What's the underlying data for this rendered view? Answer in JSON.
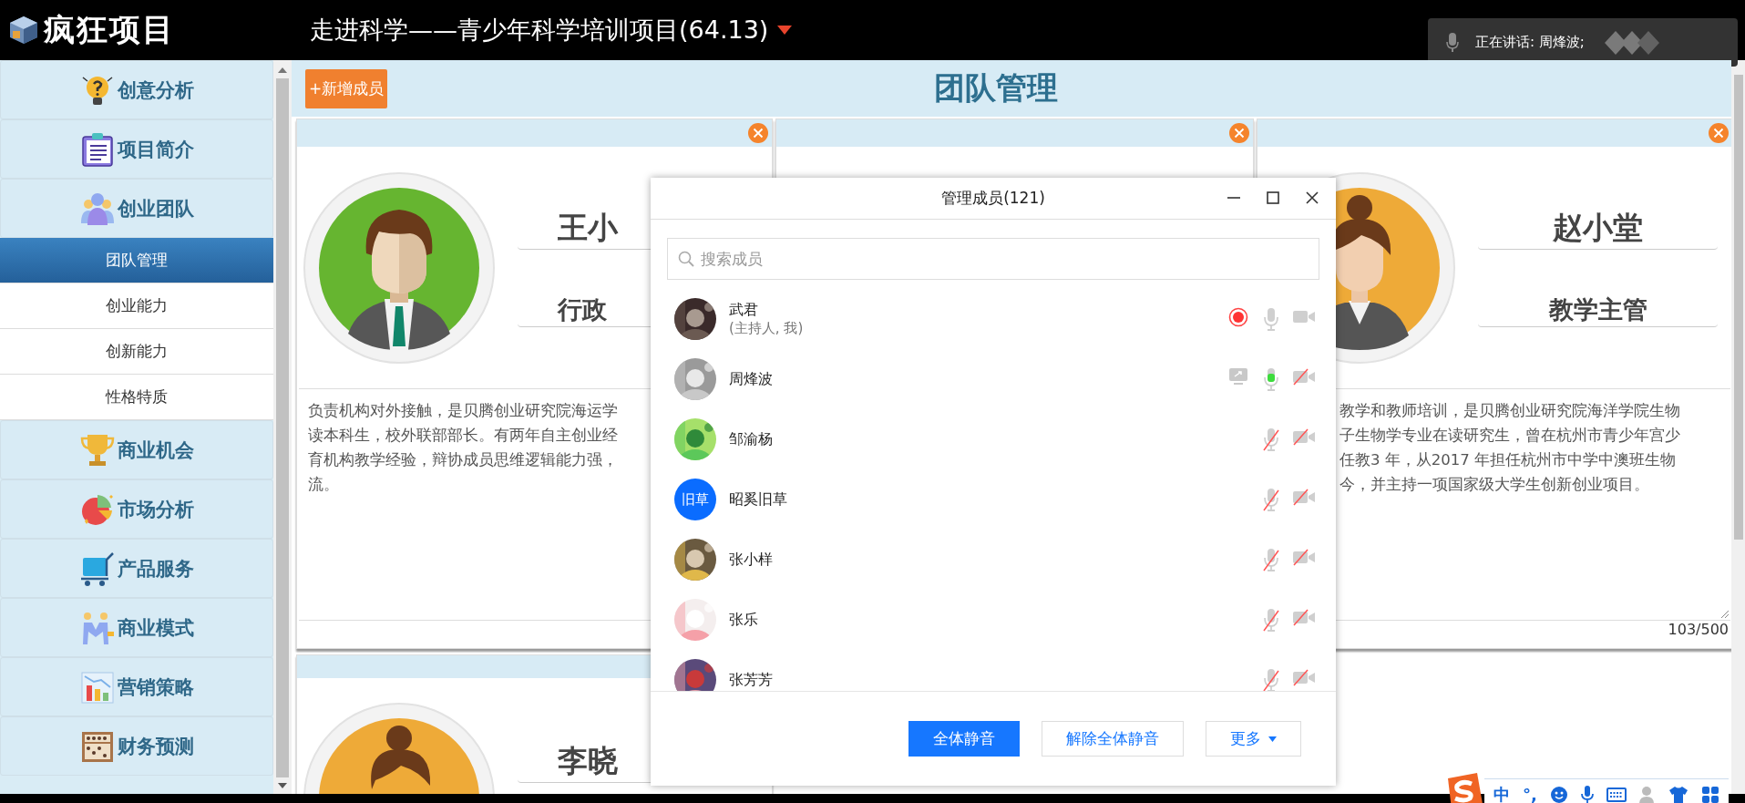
{
  "header": {
    "logo": "疯狂项目",
    "project_title": "走进科学——青少年科学培训项目(64.13)"
  },
  "speaking_indicator": {
    "label": "正在讲话: 周烽波;"
  },
  "sidebar": {
    "items": [
      {
        "label": "创意分析"
      },
      {
        "label": "项目简介"
      },
      {
        "label": "创业团队",
        "children": [
          {
            "label": "团队管理",
            "selected": true
          },
          {
            "label": "创业能力",
            "selected": false
          },
          {
            "label": "创新能力",
            "selected": false
          },
          {
            "label": "性格特质",
            "selected": false
          }
        ]
      },
      {
        "label": "商业机会"
      },
      {
        "label": "市场分析"
      },
      {
        "label": "产品服务"
      },
      {
        "label": "商业模式"
      },
      {
        "label": "营销策略"
      },
      {
        "label": "财务预测"
      }
    ]
  },
  "page": {
    "add_button": "+新增成员",
    "title": "团队管理"
  },
  "cards": [
    {
      "kind": "profile",
      "name": "王小",
      "role": "行政",
      "description_lines": [
        "负责机构对外接触，是贝腾创业研究院海运学",
        "读本科生，校外联部部长。有两年自主创业经",
        "育机构教学经验，辩协成员思维逻辑能力强，",
        "流。"
      ]
    },
    {
      "kind": "covered"
    },
    {
      "kind": "profile",
      "name": "赵小堂",
      "role": "教学主管",
      "description_lines": [
        "教学和教师培训，是贝腾创业研究院海洋学院生物",
        "子生物学专业在读研究生，曾在杭州市青少年宫少",
        "任教3 年，从2017 年担任杭州市中学中澳班生物",
        "今，并主持一项国家级大学生创新创业项目。"
      ],
      "counter": "103/500"
    }
  ],
  "cards_row_2": [
    {
      "name": "李晓"
    }
  ],
  "dialog": {
    "title": "管理成员(121)",
    "search": {
      "placeholder": "搜索成员"
    },
    "members": [
      {
        "name": "武君",
        "note": "(主持人, 我)",
        "recording": true,
        "sharing": false,
        "mic_muted": false,
        "speaking": false,
        "camera_off": false
      },
      {
        "name": "周烽波",
        "recording": false,
        "sharing": true,
        "mic_muted": false,
        "speaking": true,
        "camera_off": true
      },
      {
        "name": "邹渝杨",
        "recording": false,
        "sharing": false,
        "mic_muted": true,
        "speaking": false,
        "camera_off": true
      },
      {
        "name": "昭奚旧草",
        "avatar": {
          "kind": "text",
          "text": "旧草"
        },
        "recording": false,
        "sharing": false,
        "mic_muted": true,
        "speaking": false,
        "camera_off": true
      },
      {
        "name": "张小样",
        "recording": false,
        "sharing": false,
        "mic_muted": true,
        "speaking": false,
        "camera_off": true
      },
      {
        "name": "张乐",
        "recording": false,
        "sharing": false,
        "mic_muted": true,
        "speaking": false,
        "camera_off": true
      },
      {
        "name": "张芳芳",
        "recording": false,
        "sharing": false,
        "mic_muted": true,
        "speaking": false,
        "camera_off": true
      }
    ],
    "buttons": [
      {
        "label": "全体静音",
        "primary": true,
        "menu": false
      },
      {
        "label": "解除全体静音",
        "primary": false,
        "menu": false
      },
      {
        "label": "更多",
        "primary": false,
        "menu": true
      }
    ]
  },
  "ime_toolbar": {
    "items": [
      "中",
      "°,"
    ]
  }
}
